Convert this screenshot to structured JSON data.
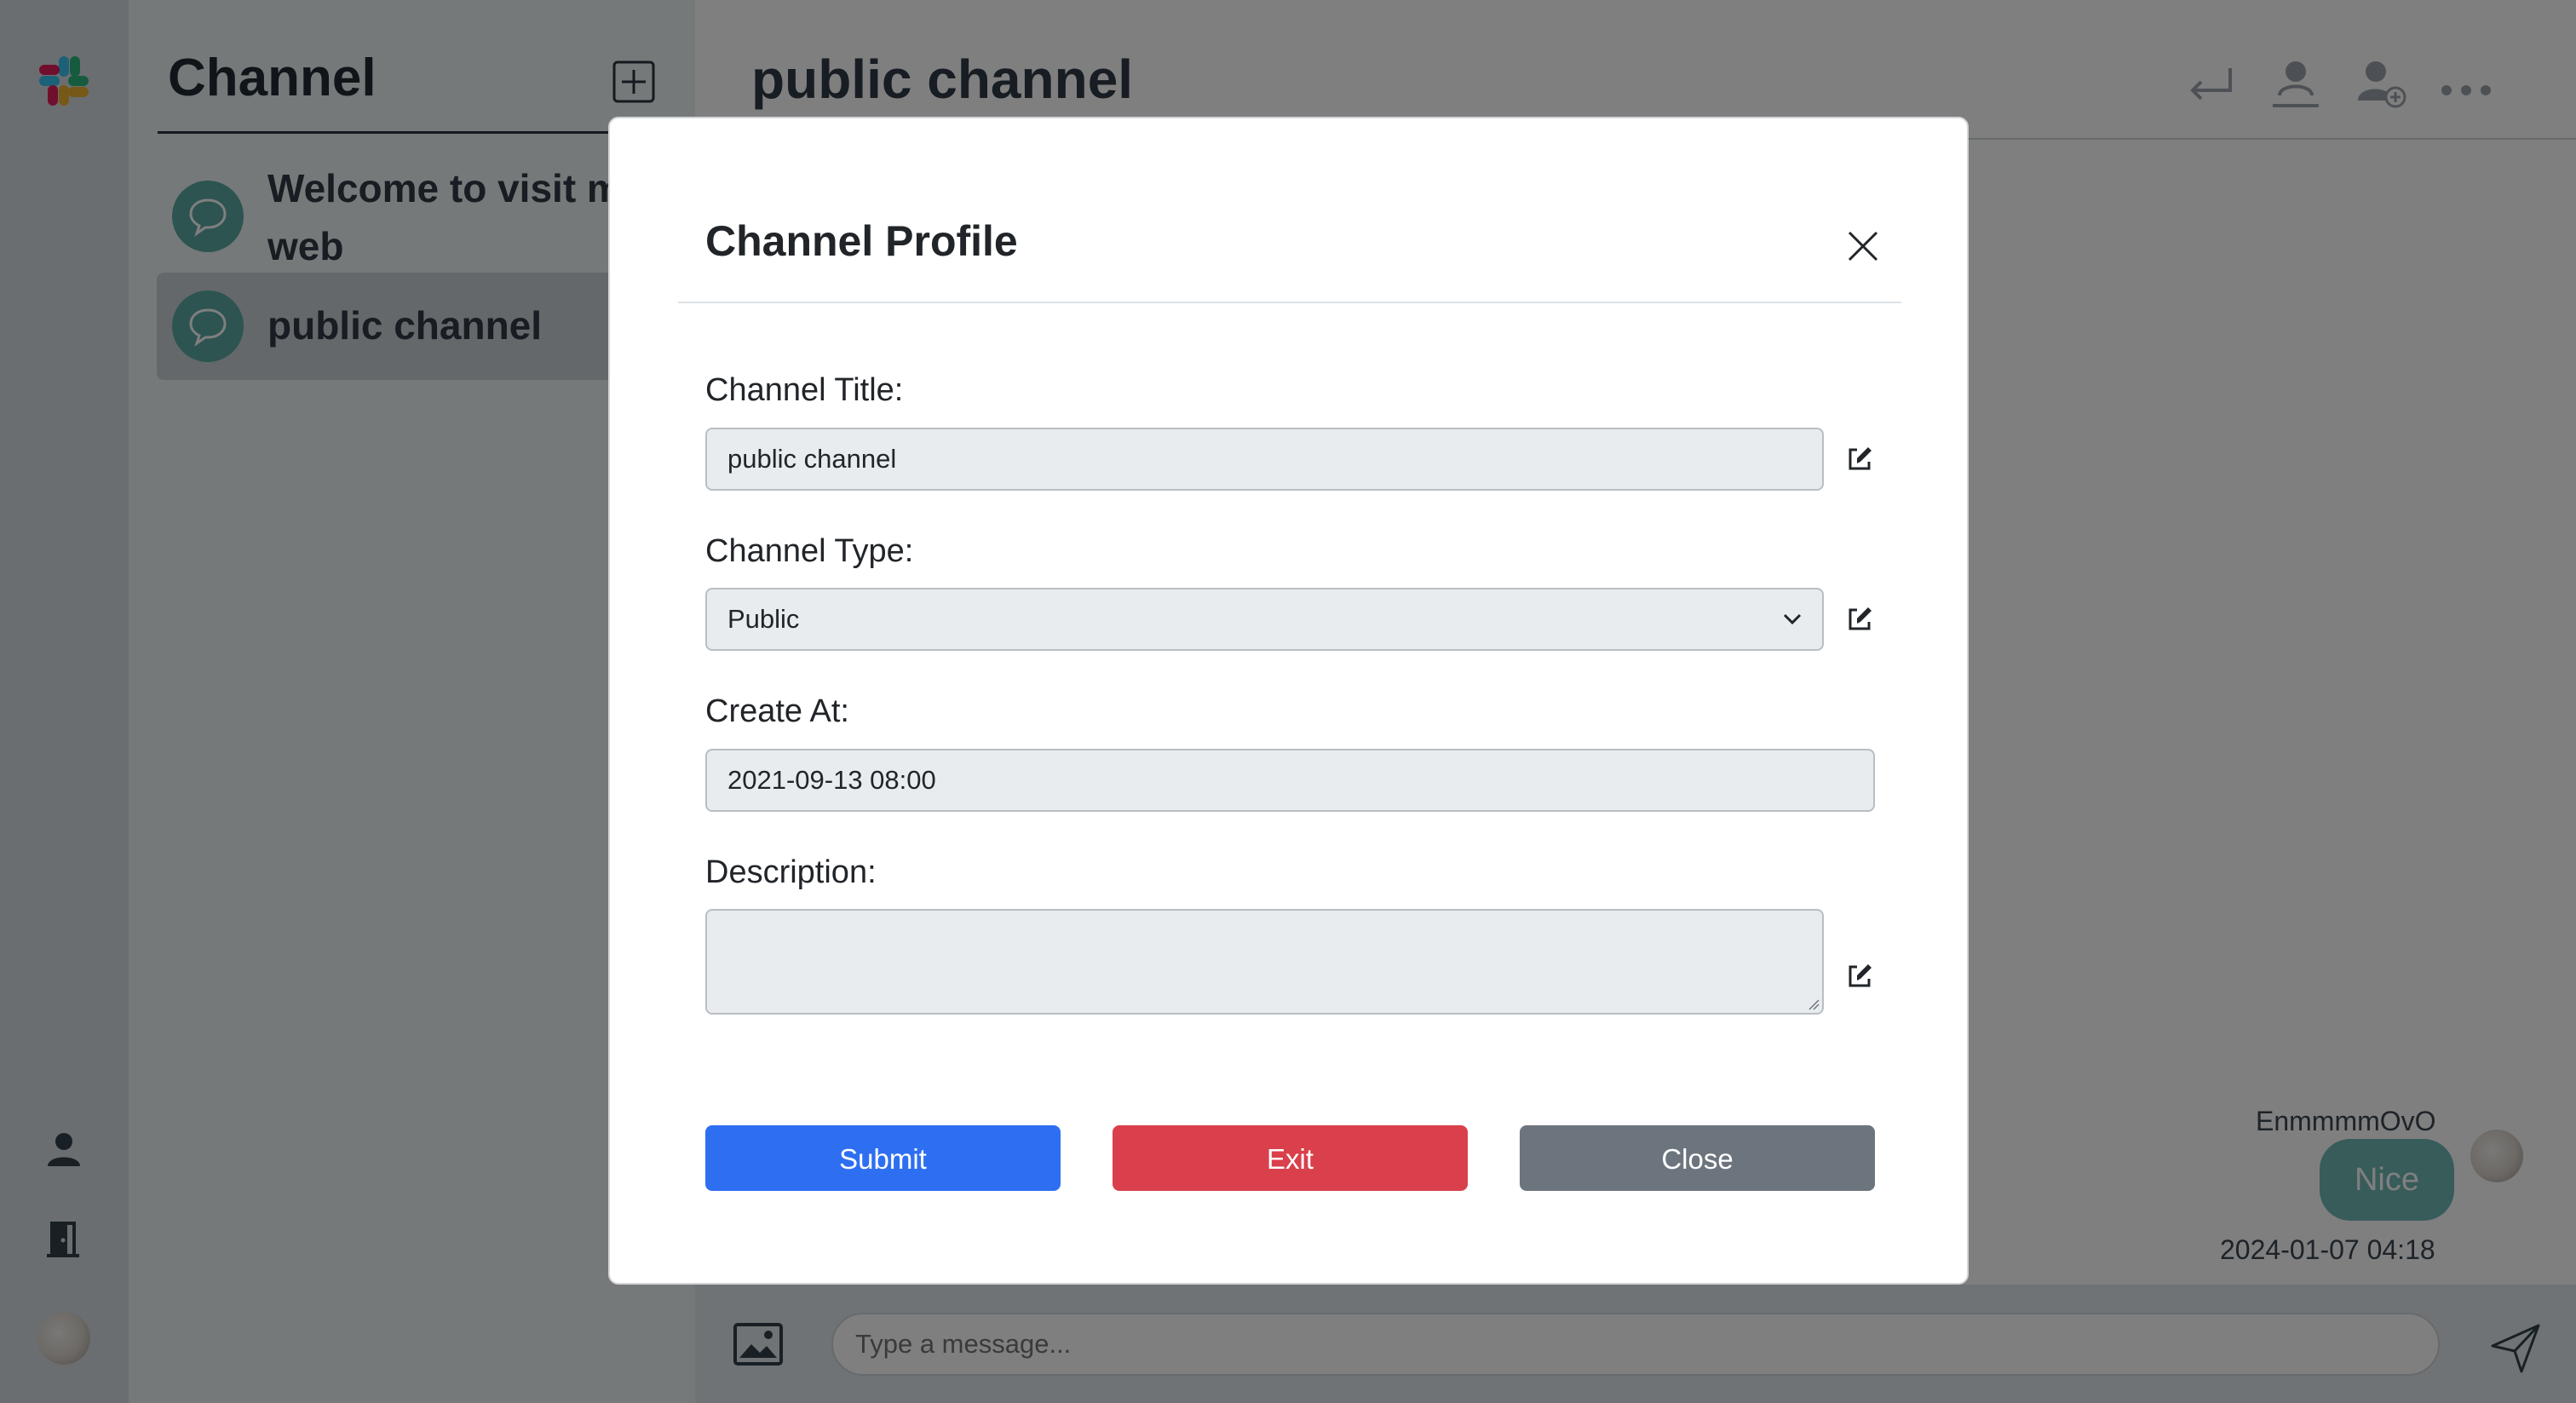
{
  "rail": {
    "logo_icon": "slack-logo-icon",
    "items": [
      {
        "icon": "user-icon"
      },
      {
        "icon": "door-exit-icon"
      },
      {
        "icon": "avatar"
      }
    ]
  },
  "sidebar": {
    "title": "Channel",
    "add_icon": "plus-square-icon",
    "channels": [
      {
        "label": "Welcome to visit my\nweb",
        "icon": "chat-bubble-icon"
      },
      {
        "label": "public channel",
        "icon": "chat-bubble-icon",
        "active": true
      }
    ]
  },
  "main": {
    "title": "public channel",
    "header_icons": [
      "reply-arrow-icon",
      "member-list-icon",
      "add-user-icon",
      "more-dots-icon"
    ],
    "messages": [
      {
        "sender": "EnmmmmOvO",
        "text": "Nice",
        "time": "2024-01-07 04:18"
      }
    ],
    "composer": {
      "placeholder": "Type a message...",
      "image_icon": "image-icon",
      "send_icon": "send-icon"
    }
  },
  "modal": {
    "title": "Channel Profile",
    "close_icon": "close-icon",
    "fields": {
      "title_label": "Channel Title:",
      "title_value": "public channel",
      "type_label": "Channel Type:",
      "type_value": "Public",
      "created_label": "Create At:",
      "created_value": "2021-09-13 08:00",
      "description_label": "Description:",
      "description_value": ""
    },
    "buttons": {
      "submit": "Submit",
      "exit": "Exit",
      "close": "Close"
    }
  },
  "colors": {
    "submit": "#2e6ff2",
    "exit": "#d9404b",
    "close": "#6c757d",
    "bubble": "#6fb8b4",
    "rail": "#d7dde0",
    "sidebar": "#eaf3f3"
  }
}
